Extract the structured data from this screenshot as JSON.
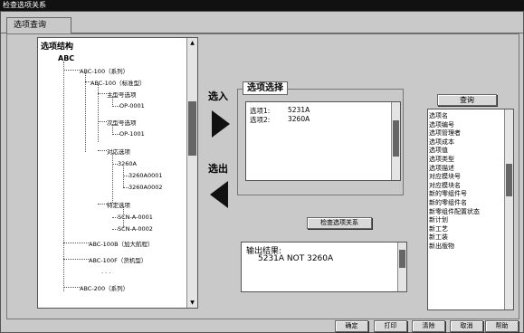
{
  "window": {
    "title": "检查选项关系"
  },
  "tabs": [
    {
      "label": "选项查询"
    }
  ],
  "tree": {
    "title": "选项结构",
    "nodes": [
      "ABC",
      "ABC-100（系列）",
      "ABC-100（标准型）",
      "主型号选项",
      "OP-0001",
      "次型号选项",
      "OP-1001",
      "对応选项",
      "3260A",
      "3260A0001",
      "3260A0002",
      "特定选项",
      "SCN-A-0001",
      "SCN-A-0002",
      "ABC-100B（加大航程）",
      "ABC-100F（货机型）",
      ". . .",
      "ABC-200（系列）"
    ]
  },
  "transfer": {
    "in_label": "选入",
    "out_label": "选出"
  },
  "selection": {
    "title": "选项选择",
    "items": [
      {
        "key": "选项1:",
        "value": "5231A"
      },
      {
        "key": "选项2:",
        "value": "3260A"
      }
    ]
  },
  "check_button": "检查选项关系",
  "output": {
    "label": "输出结果:",
    "value": "5231A NOT 3260A"
  },
  "query": {
    "button": "查询",
    "fields": [
      "选项名",
      "选项编号",
      "选项管理者",
      "选项成本",
      "选项值",
      "选项类型",
      "选项描述",
      "对应模块号",
      "对应模块名",
      "新的零组件号",
      "新的零组件名",
      "新零组件配置状态",
      "新计划",
      "新工艺",
      "新工装",
      "新出版物"
    ]
  },
  "footer": {
    "buttons": [
      "确定",
      "打印",
      "清除",
      "取消",
      "帮助"
    ]
  }
}
